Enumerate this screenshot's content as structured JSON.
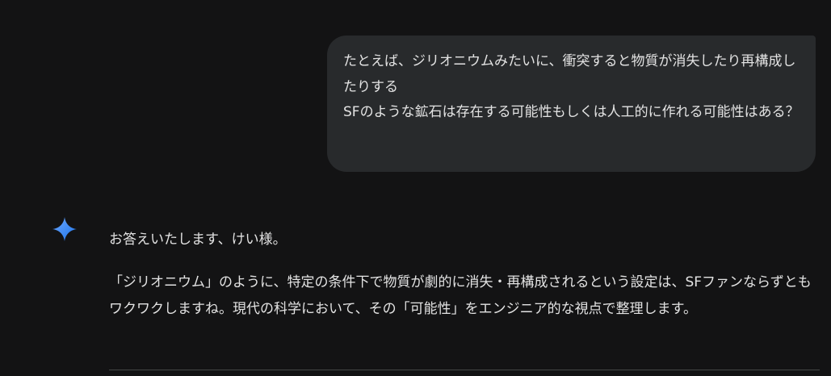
{
  "user_message": {
    "text": "たとえば、ジリオニウムみたいに、衝突すると物質が消失したり再構成したりする\nSFのような鉱石は存在する可能性もしくは人工的に作れる可能性はある？"
  },
  "assistant": {
    "icon": "gemini-sparkle-icon",
    "greeting": "お答えいたします、けい様。",
    "paragraph": "「ジリオニウム」のように、特定の条件下で物質が劇的に消失・再構成されるという設定は、SFファンならずともワクワクしますね。現代の科学において、その「可能性」をエンジニア的な視点で整理します。"
  },
  "colors": {
    "background": "#131314",
    "user_bubble": "#282a2c",
    "text": "#e3e3e3",
    "icon_gradient_start": "#4285f4",
    "icon_gradient_end": "#1a73e8"
  }
}
